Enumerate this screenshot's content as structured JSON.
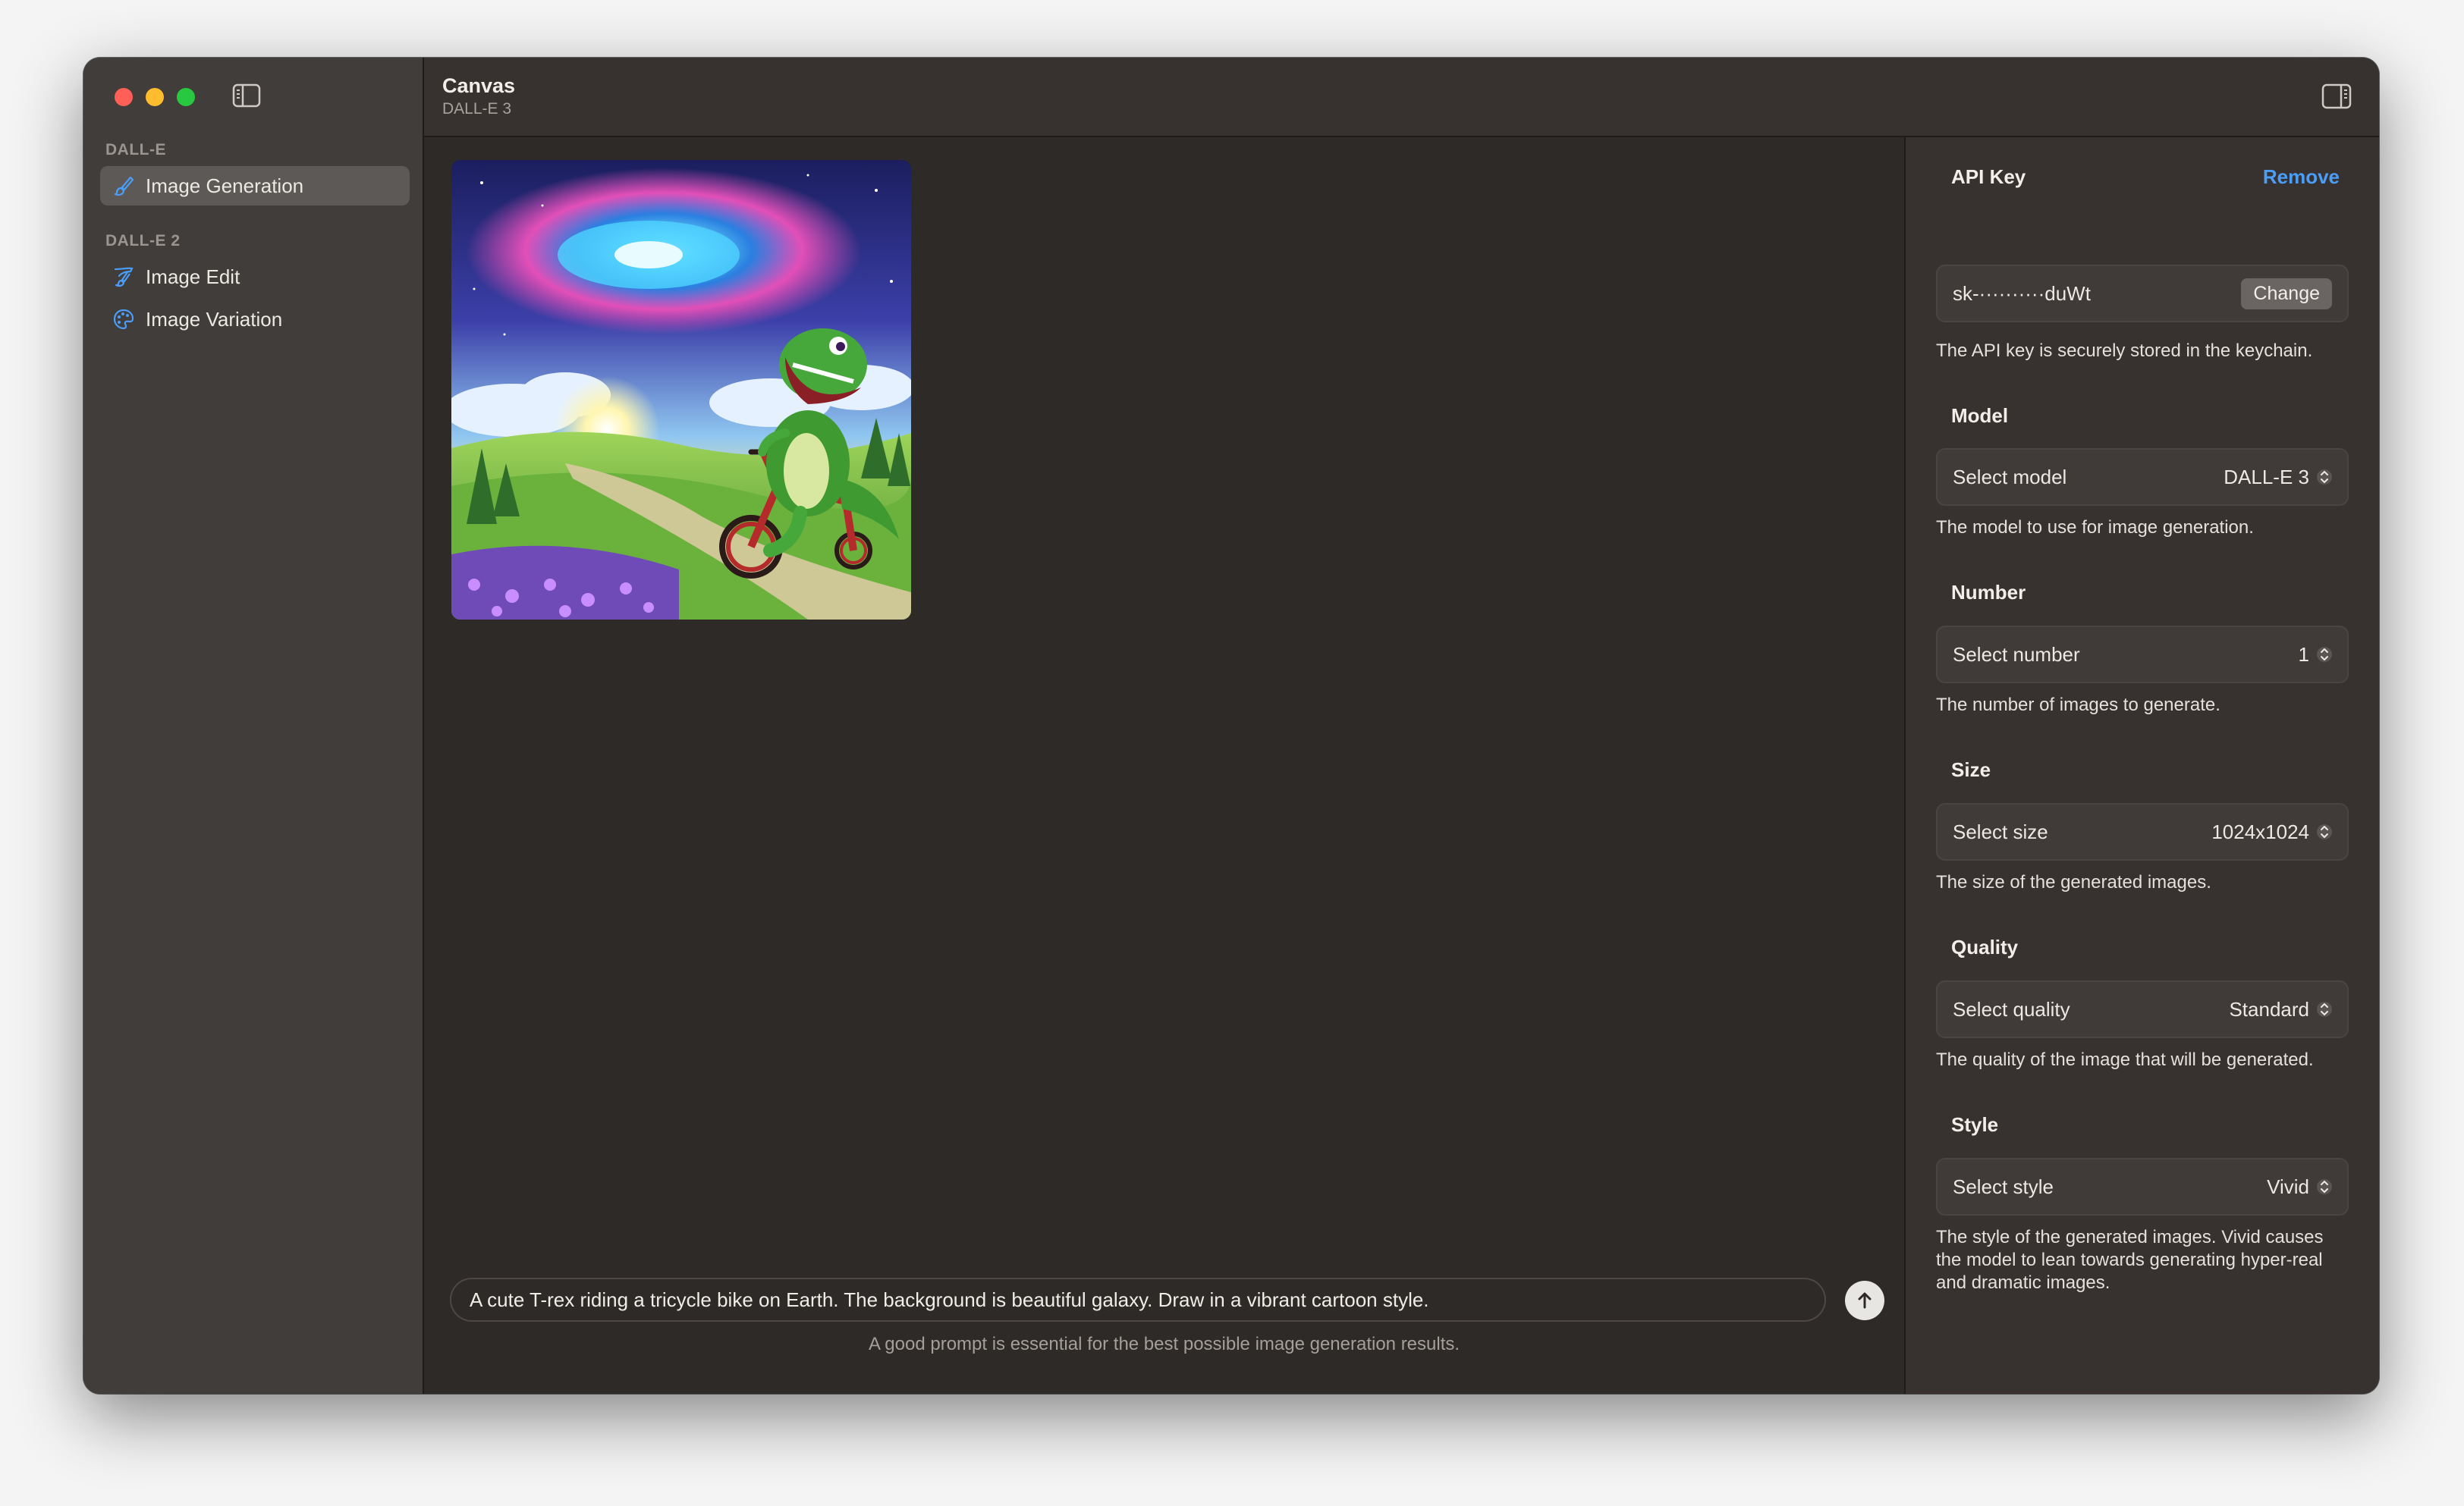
{
  "window": {
    "traffic_lights": [
      "close",
      "minimize",
      "zoom"
    ]
  },
  "sidebar": {
    "sections": [
      {
        "title": "DALL-E",
        "items": [
          {
            "label": "Image Generation",
            "icon": "paintbrush-pointed-icon",
            "selected": true
          }
        ]
      },
      {
        "title": "DALL-E 2",
        "items": [
          {
            "label": "Image Edit",
            "icon": "paintbrush-icon",
            "selected": false
          },
          {
            "label": "Image Variation",
            "icon": "paint-palette-icon",
            "selected": false
          }
        ]
      }
    ]
  },
  "header": {
    "title": "Canvas",
    "subtitle": "DALL-E 3"
  },
  "canvas": {
    "image_alt": "Cartoon T-rex riding a red tricycle on a path through green hills under a swirling galaxy sky",
    "prompt_value": "A cute T-rex riding a tricycle bike on Earth. The background is beautiful galaxy. Draw in a vibrant cartoon style.",
    "prompt_hint": "A good prompt is essential for the best possible image generation results.",
    "send_icon": "arrow-up-icon"
  },
  "inspector": {
    "api_key": {
      "label": "API Key",
      "remove_label": "Remove",
      "masked_value": "sk-··········duWt",
      "change_label": "Change",
      "help": "The API key is securely stored in the keychain."
    },
    "model": {
      "label": "Model",
      "field_label": "Select model",
      "value": "DALL-E 3",
      "help": "The model to use for image generation."
    },
    "number": {
      "label": "Number",
      "field_label": "Select number",
      "value": "1",
      "help": "The number of images to generate."
    },
    "size": {
      "label": "Size",
      "field_label": "Select size",
      "value": "1024x1024",
      "help": "The size of the generated images."
    },
    "quality": {
      "label": "Quality",
      "field_label": "Select quality",
      "value": "Standard",
      "help": "The quality of the image that will be generated."
    },
    "style": {
      "label": "Style",
      "field_label": "Select style",
      "value": "Vivid",
      "help": "The style of the generated images. Vivid causes the model to lean towards generating hyper-real and dramatic images."
    }
  },
  "colors": {
    "accent": "#4a9df8",
    "window_bg": "#2e2a27",
    "sidebar_bg": "#413d3b"
  }
}
